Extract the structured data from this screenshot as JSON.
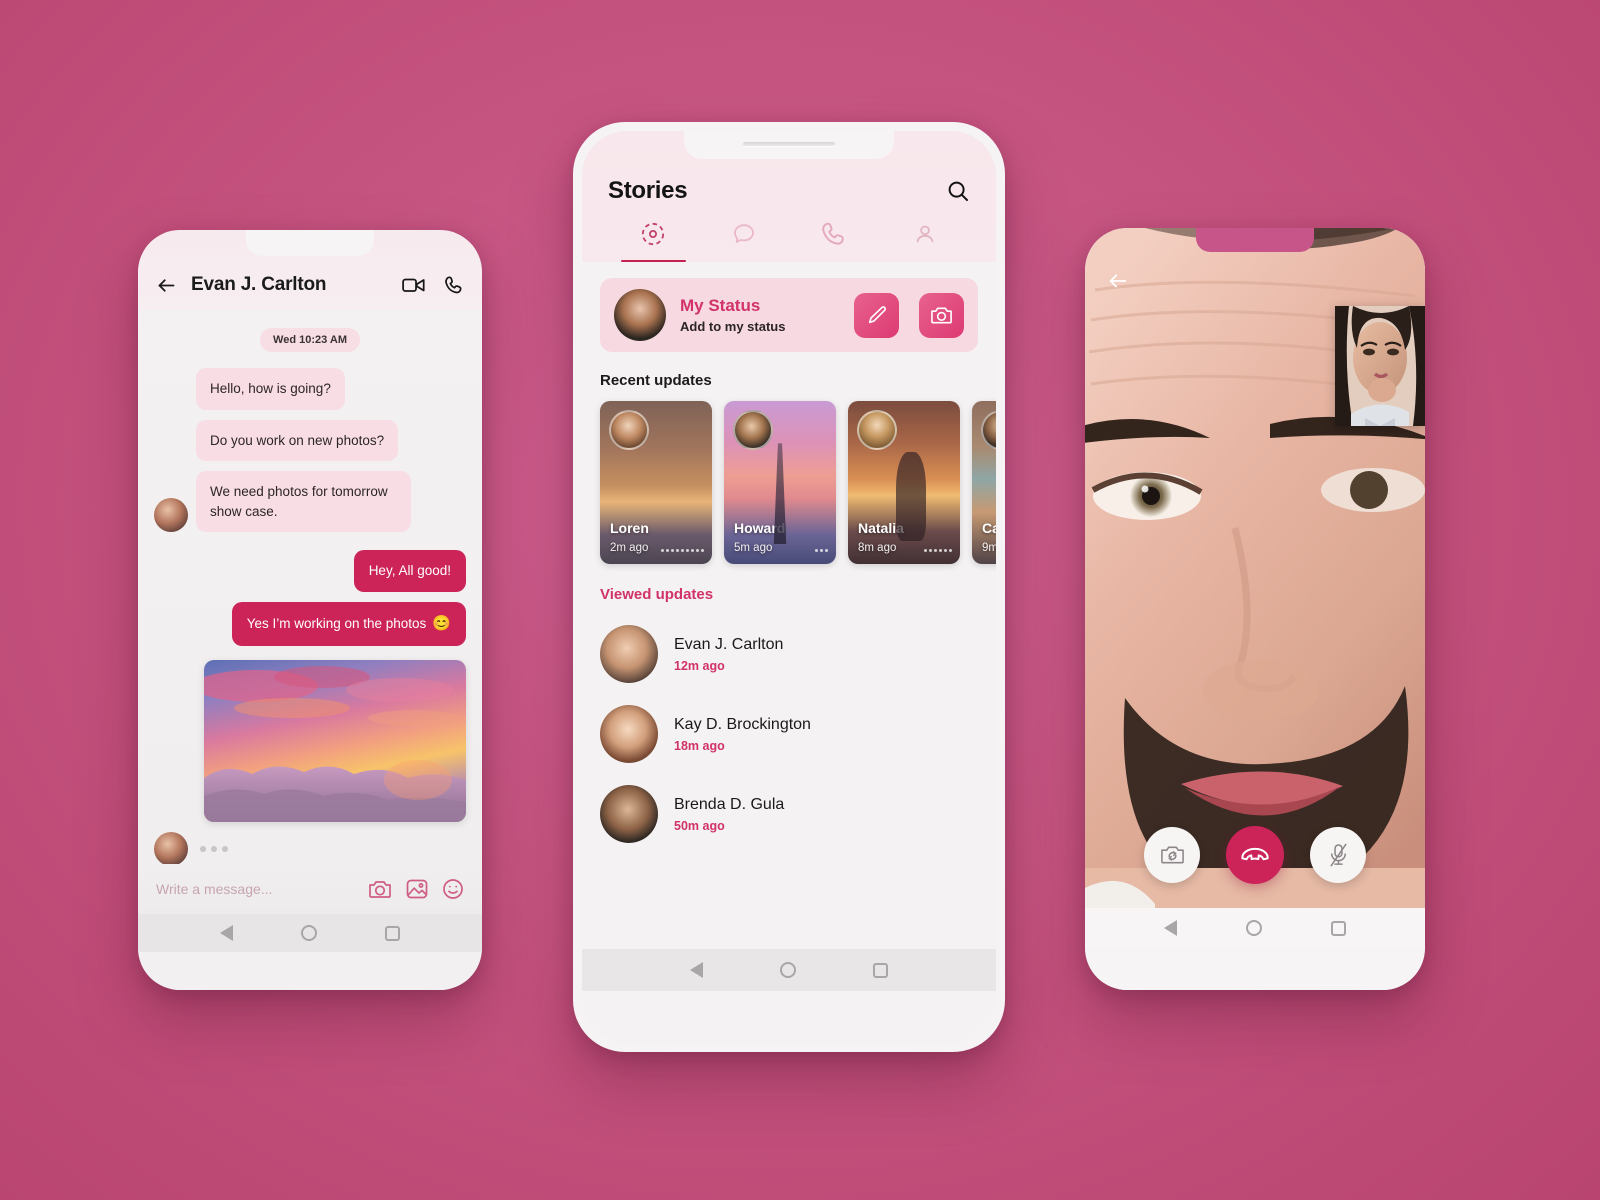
{
  "theme": {
    "background": "#c8558a",
    "accent": "#cc2459",
    "accent_soft": "#d1326a",
    "bubble_in": "#f8dde5",
    "bubble_out": "#cc2459",
    "screen_bg": "#f4f2f2",
    "header_pink": "#f8e7ec"
  },
  "chat_phone": {
    "header": {
      "back_icon": "arrow-left-icon",
      "contact_name": "Evan J. Carlton",
      "video_icon": "video-camera-icon",
      "call_icon": "phone-icon"
    },
    "day_stamp": "Wed 10:23 AM",
    "messages": [
      {
        "id": 1,
        "side": "in",
        "type": "text",
        "text": "Hello, how is going?",
        "show_avatar": false
      },
      {
        "id": 2,
        "side": "in",
        "type": "text",
        "text": "Do you work on new photos?",
        "show_avatar": false
      },
      {
        "id": 3,
        "side": "in",
        "type": "text",
        "text": "We need photos for tomorrow show case.",
        "show_avatar": true
      },
      {
        "id": 4,
        "side": "out",
        "type": "text",
        "text": "Hey, All good!"
      },
      {
        "id": 5,
        "side": "out",
        "type": "text",
        "text": "Yes I’m working on the photos",
        "emoji": "😊"
      },
      {
        "id": 6,
        "side": "out",
        "type": "image",
        "alt": "sunset clouds photo"
      }
    ],
    "typing_indicator": "• • •",
    "input": {
      "placeholder": "Write a message...",
      "camera_icon": "camera-icon",
      "gallery_icon": "image-icon",
      "emoji_icon": "smiley-icon"
    },
    "android_nav": {
      "back": "triangle-back-icon",
      "home": "circle-home-icon",
      "recents": "square-recents-icon"
    }
  },
  "stories_phone": {
    "header": {
      "title": "Stories",
      "search_icon": "search-icon"
    },
    "tabs": [
      {
        "id": "stories",
        "icon": "status-ring-icon",
        "active": true
      },
      {
        "id": "chats",
        "icon": "chat-bubble-icon",
        "active": false
      },
      {
        "id": "calls",
        "icon": "phone-icon",
        "active": false
      },
      {
        "id": "profile",
        "icon": "person-icon",
        "active": false
      }
    ],
    "my_status": {
      "title": "My Status",
      "subtitle": "Add to my status",
      "edit_icon": "pencil-icon",
      "camera_icon": "camera-icon"
    },
    "recent_updates": {
      "section_title": "Recent updates",
      "cards": [
        {
          "name": "Loren",
          "time": "2m ago",
          "segments": 9
        },
        {
          "name": "Howard",
          "time": "5m ago",
          "segments": 3
        },
        {
          "name": "Natalia",
          "time": "8m ago",
          "segments": 6
        },
        {
          "name": "Ca",
          "time": "9m",
          "segments": 4
        }
      ]
    },
    "viewed_updates": {
      "section_title": "Viewed updates",
      "rows": [
        {
          "name": "Evan J. Carlton",
          "time": "12m ago"
        },
        {
          "name": "Kay D. Brockington",
          "time": "18m ago"
        },
        {
          "name": "Brenda D. Gula",
          "time": "50m ago"
        }
      ]
    },
    "android_nav": {
      "back": "triangle-back-icon",
      "home": "circle-home-icon",
      "recents": "square-recents-icon"
    }
  },
  "call_phone": {
    "back_icon": "arrow-left-icon",
    "pip_label": "self-view",
    "controls": [
      {
        "id": "switch-camera",
        "icon": "camera-switch-icon",
        "style": "light"
      },
      {
        "id": "end-call",
        "icon": "phone-hangup-icon",
        "style": "end"
      },
      {
        "id": "mute",
        "icon": "mic-off-icon",
        "style": "light"
      }
    ],
    "android_nav": {
      "back": "triangle-back-icon",
      "home": "circle-home-icon",
      "recents": "square-recents-icon"
    }
  }
}
